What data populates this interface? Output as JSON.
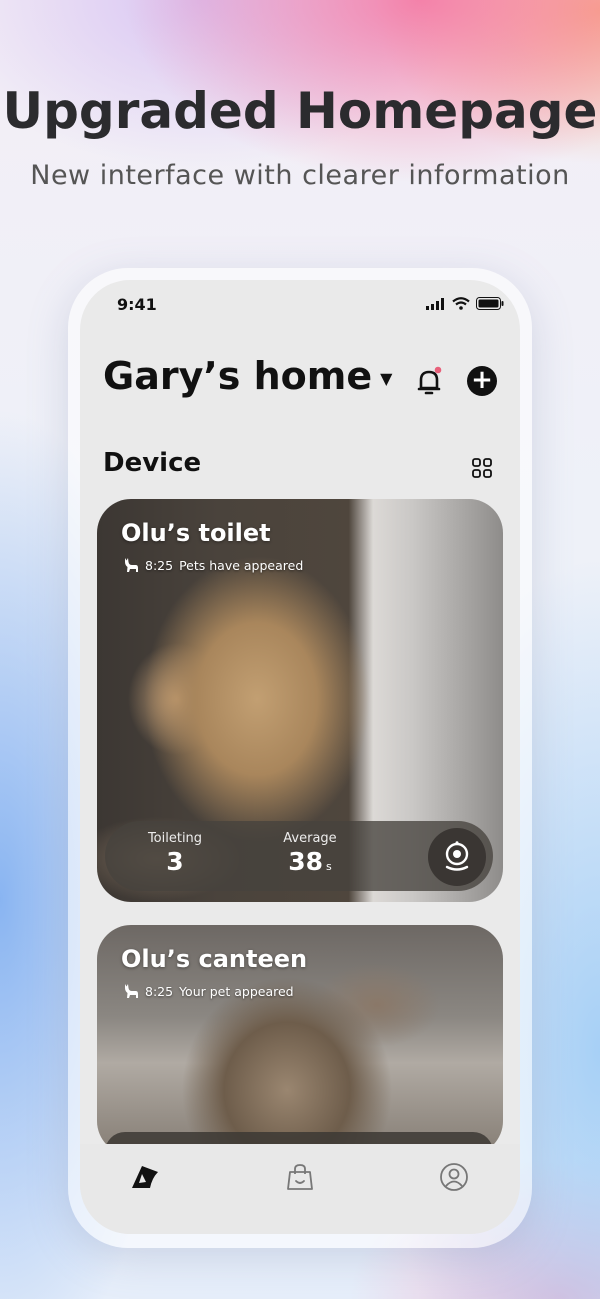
{
  "promo": {
    "headline": "Upgraded Homepage",
    "subline": "New interface with clearer information"
  },
  "status_bar": {
    "time": "9:41",
    "icons": [
      "signal-icon",
      "wifi-icon",
      "battery-icon"
    ]
  },
  "header": {
    "home_name": "Gary’s home",
    "dropdown_icon": "caret-down-icon",
    "notification_icon": "bell-icon",
    "add_icon": "plus-icon"
  },
  "devices_section": {
    "title": "Device",
    "view_icon": "grid-view-icon"
  },
  "devices": [
    {
      "name": "Olu’s toilet",
      "event_time": "8:25",
      "event_text": "Pets have appeared",
      "stats": [
        {
          "label": "Toileting",
          "value": "3",
          "unit": ""
        },
        {
          "label": "Average",
          "value": "38",
          "unit": "s"
        }
      ],
      "action_icon": "camera-icon"
    },
    {
      "name": "Olu’s canteen",
      "event_time": "8:25",
      "event_text": "Your pet appeared"
    }
  ],
  "tab_bar": {
    "tabs": [
      {
        "icon": "home-logo-icon",
        "active": true
      },
      {
        "icon": "shop-bag-icon",
        "active": false
      },
      {
        "icon": "profile-icon",
        "active": false
      }
    ]
  },
  "colors": {
    "accent_dot": "#e8607a",
    "text_primary": "#111111"
  }
}
